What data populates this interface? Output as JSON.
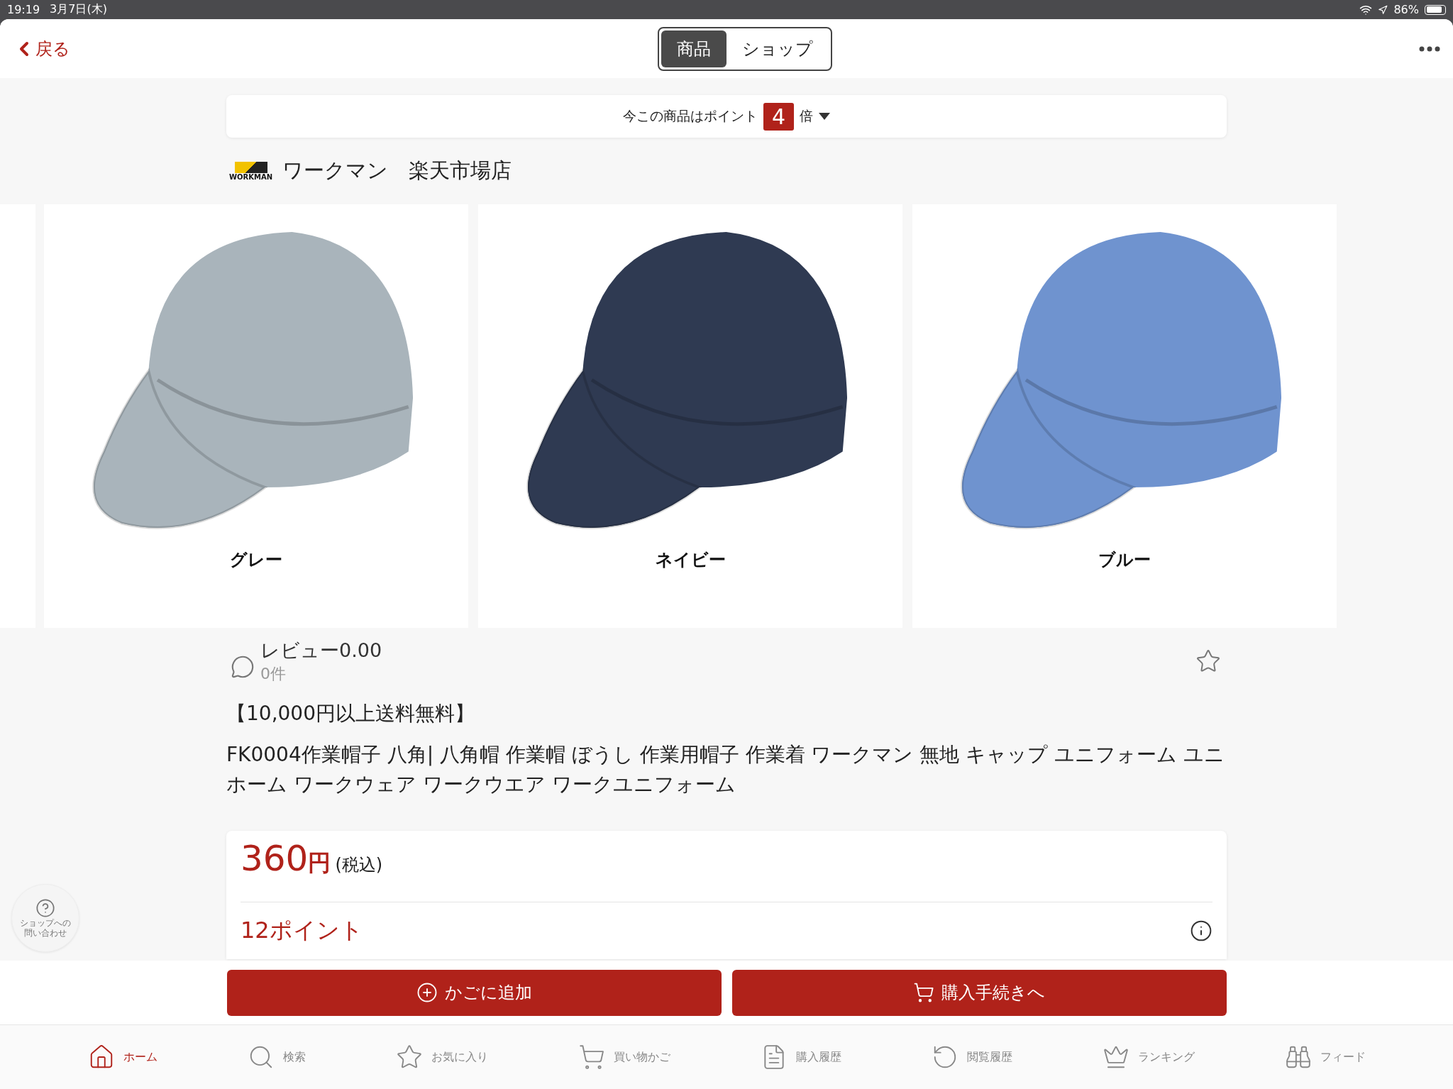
{
  "status_bar": {
    "time": "19:19",
    "date": "3月7日(木)",
    "battery": "86%"
  },
  "nav": {
    "back": "戻る",
    "segments": [
      {
        "label": "商品",
        "selected": true
      },
      {
        "label": "ショップ",
        "selected": false
      }
    ]
  },
  "points_banner": {
    "text": "今この商品はポイント",
    "multiplier": "4",
    "suffix": "倍"
  },
  "store": {
    "logo_text": "WORKMAN",
    "name": "ワークマン　楽天市場店"
  },
  "variants": [
    {
      "label": "グレー",
      "color": "#a9b4bb"
    },
    {
      "label": "ネイビー",
      "color": "#2f3a52"
    },
    {
      "label": "ブルー",
      "color": "#6f93cf"
    }
  ],
  "review": {
    "title": "レビュー0.00",
    "count": "0件",
    "favorited": false
  },
  "shipping_note": "【10,000円以上送料無料】",
  "title": "FK0004作業帽子 八角| 八角帽 作業帽 ぼうし 作業用帽子 作業着 ワークマン 無地 キャップ ユニフォーム ユニホーム ワークウェア ワークウエア ワークユニフォーム",
  "price": {
    "amount": "360",
    "unit": "円",
    "tax": "(税込)",
    "points": "12ポイント"
  },
  "help_button": {
    "lines": [
      "ショップへの",
      "問い合わせ"
    ]
  },
  "actions": [
    {
      "kind": "add",
      "label": "かごに追加"
    },
    {
      "kind": "checkout",
      "label": "購入手続きへ"
    }
  ],
  "tabs": [
    {
      "kind": "home",
      "label": "ホーム",
      "selected": true
    },
    {
      "kind": "search",
      "label": "検索",
      "selected": false
    },
    {
      "kind": "favorites",
      "label": "お気に入り",
      "selected": false
    },
    {
      "kind": "cart",
      "label": "買い物かご",
      "selected": false
    },
    {
      "kind": "history",
      "label": "購入履歴",
      "selected": false
    },
    {
      "kind": "viewed",
      "label": "閲覧履歴",
      "selected": false
    },
    {
      "kind": "ranking",
      "label": "ランキング",
      "selected": false
    },
    {
      "kind": "feed",
      "label": "フィード",
      "selected": false
    }
  ]
}
